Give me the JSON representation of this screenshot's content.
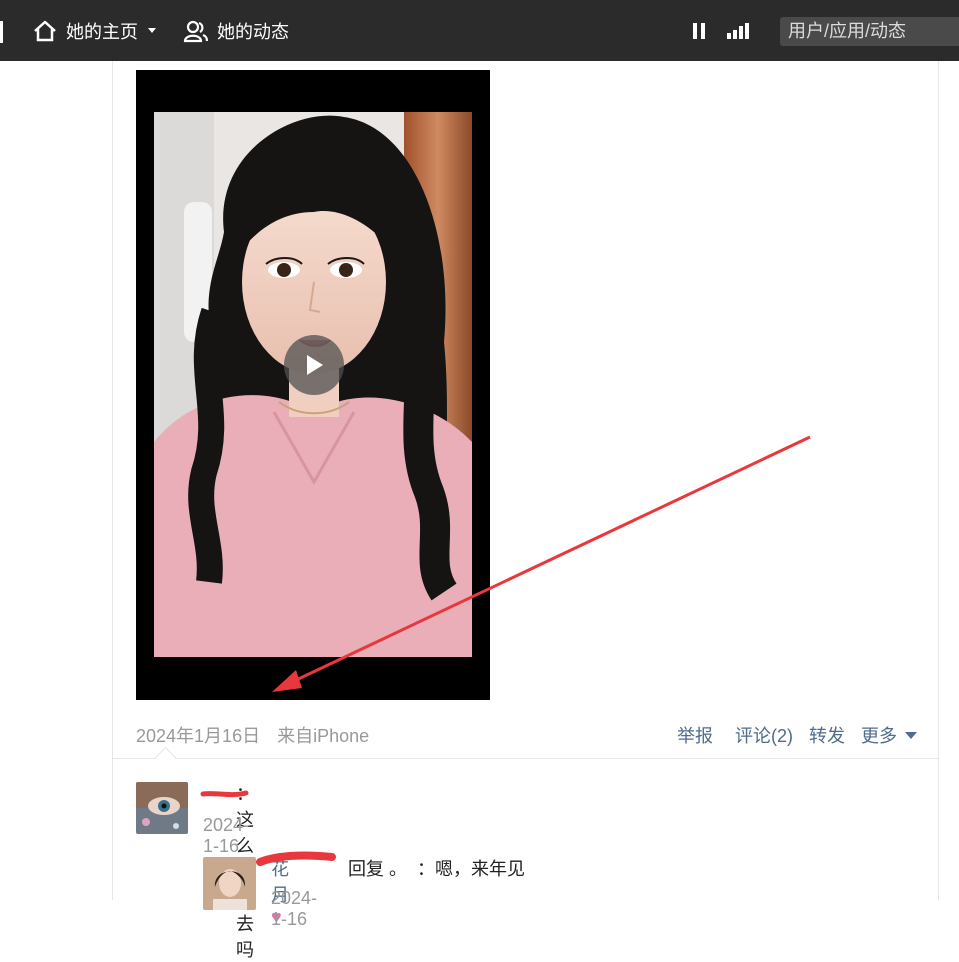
{
  "topbar": {
    "home_label": "她的主页",
    "feed_label": "她的动态",
    "search_placeholder": "用户/应用/动态"
  },
  "post": {
    "date": "2024年1月16日",
    "source": "来自iPhone",
    "actions": {
      "report": "举报",
      "comment": "评论(2)",
      "forward": "转发",
      "more": "更多"
    }
  },
  "comments": [
    {
      "text": "：这么早回去吗",
      "time": "2024-1-16"
    },
    {
      "user": "花月",
      "reply_text": "回复 。  ：嗯，来年见",
      "time": "2024-1-16"
    }
  ],
  "colors": {
    "topbar_bg": "#2b2b2b",
    "link": "#4f6b8f",
    "muted": "#999999",
    "annotation_red": "#e8383d"
  }
}
